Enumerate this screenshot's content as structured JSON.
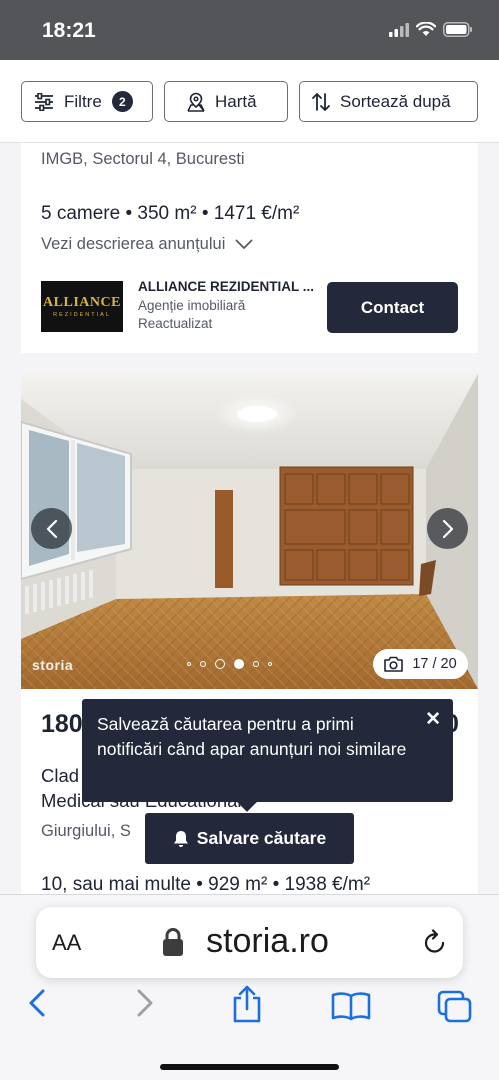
{
  "status_bar": {
    "time": "18:21"
  },
  "toolbar": {
    "filters_label": "Filtre",
    "filters_count": "2",
    "map_label": "Hartă",
    "sort_label": "Sortează după"
  },
  "listing1": {
    "address": "IMGB, Sectorul 4, Bucuresti",
    "specs": "5 camere • 350 m² • 1471 €/m²",
    "description_link": "Vezi descrierea anunțului",
    "agency": {
      "logo_text": "ALLIANCE",
      "logo_subtext": "REZIDENTIAL",
      "name": "ALLIANCE REZIDENTIAL ...",
      "type": "Agenție imobiliară",
      "status": "Reactualizat"
    },
    "contact_label": "Contact"
  },
  "listing2": {
    "photo_brand": "storia",
    "photo_counter": "17 / 20",
    "photo_dot_count": 6,
    "price_partial": "180",
    "price_partial_right": "0",
    "title_partial_line1": "Clad",
    "title_partial_line2": "Medical sau Educational",
    "address_partial": "Giurgiului, S",
    "specs": "10, sau mai multe • 929 m² • 1938 €/m²"
  },
  "save_search": {
    "tooltip_text": "Salvează căutarea pentru a primi notificări când apar anunțuri noi similare",
    "button_label": "Salvare căutare"
  },
  "browser": {
    "text_size_label": "AA",
    "url": "storia.ro"
  },
  "colors": {
    "primary_dark": "#23293a",
    "status_bar": "#545558",
    "page_bg": "#f4f4f6",
    "logo_gold": "#d8b441"
  },
  "icons": [
    "signal-icon",
    "wifi-icon",
    "battery-icon",
    "sliders-icon",
    "map-pin-icon",
    "sort-arrows-icon",
    "chevron-down-icon",
    "chevron-left-icon",
    "chevron-right-icon",
    "camera-icon",
    "close-icon",
    "bell-icon",
    "lock-icon",
    "reload-icon",
    "back-icon",
    "forward-icon",
    "share-icon",
    "bookmarks-icon",
    "tabs-icon"
  ]
}
